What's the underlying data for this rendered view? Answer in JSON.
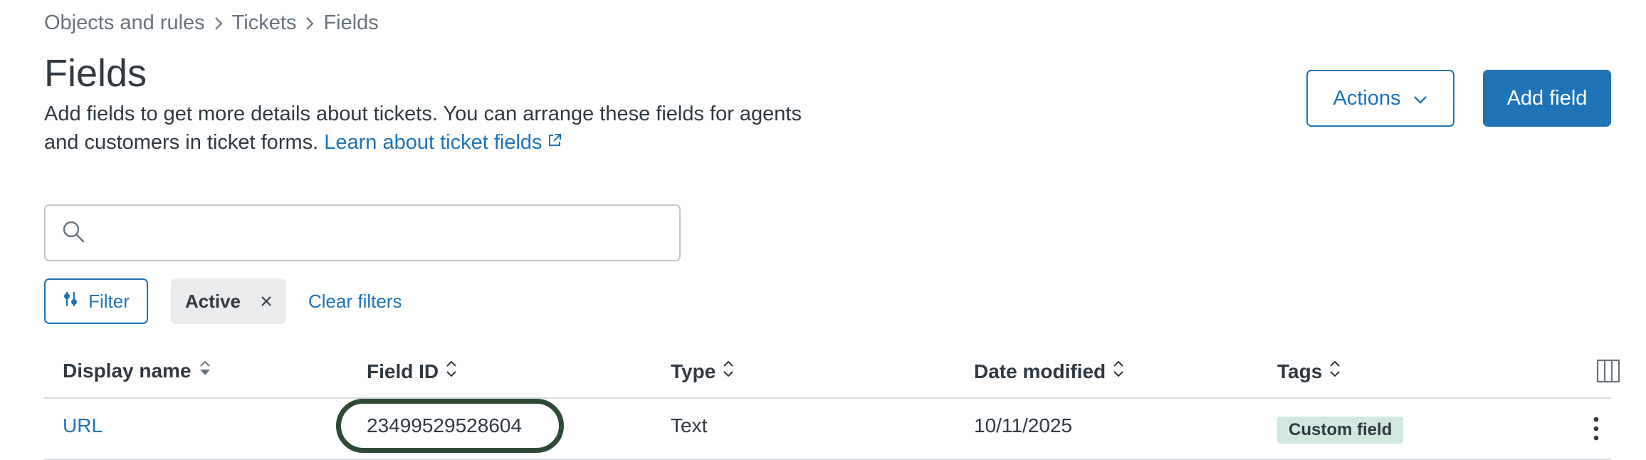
{
  "breadcrumb": {
    "items": [
      "Objects and rules",
      "Tickets",
      "Fields"
    ]
  },
  "page": {
    "title": "Fields",
    "description": "Add fields to get more details about tickets. You can arrange these fields for agents and customers in ticket forms.",
    "learn_link": "Learn about ticket fields"
  },
  "header_actions": {
    "actions_label": "Actions",
    "add_label": "Add field"
  },
  "search": {
    "value": "",
    "placeholder": ""
  },
  "filters": {
    "filter_label": "Filter",
    "active_chip": "Active",
    "clear_label": "Clear filters"
  },
  "table": {
    "columns": [
      "Display name",
      "Field ID",
      "Type",
      "Date modified",
      "Tags"
    ],
    "rows": [
      {
        "display_name": "URL",
        "field_id": "23499529528604",
        "type": "Text",
        "date_modified": "10/11/2025",
        "tag": "Custom field"
      }
    ]
  },
  "colors": {
    "accent": "#1f73b7",
    "text": "#2f3941",
    "muted": "#68737d",
    "tag_bg": "#d1e8df",
    "highlight_ring": "#2e4a36"
  }
}
